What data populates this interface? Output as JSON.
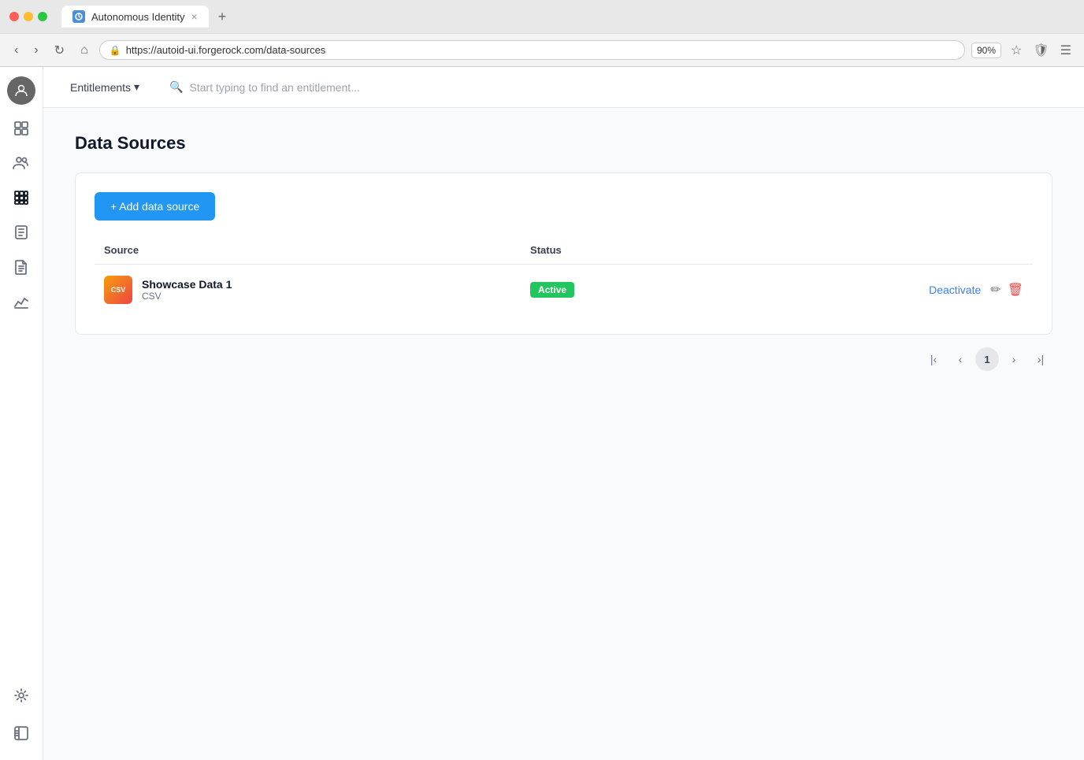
{
  "browser": {
    "tab_title": "Autonomous Identity",
    "tab_close": "×",
    "tab_add": "+",
    "address": "https://autoid-ui.forgerock.com/data-sources",
    "zoom": "90%",
    "nav": {
      "back": "‹",
      "forward": "›",
      "refresh": "↻",
      "home": "⌂"
    }
  },
  "topnav": {
    "entitlements_label": "Entitlements",
    "search_placeholder": "Start typing to find an entitlement..."
  },
  "sidebar": {
    "items": [
      {
        "id": "dashboard",
        "icon": "grid"
      },
      {
        "id": "users",
        "icon": "users"
      },
      {
        "id": "apps",
        "icon": "grid-apps"
      },
      {
        "id": "tasks",
        "icon": "check-circle"
      },
      {
        "id": "reports",
        "icon": "document"
      },
      {
        "id": "analytics",
        "icon": "chart"
      },
      {
        "id": "settings",
        "icon": "gear"
      }
    ],
    "bottom_items": [
      {
        "id": "sidebar-toggle",
        "icon": "sidebar"
      }
    ]
  },
  "page": {
    "title": "Data Sources",
    "add_button_label": "+ Add data source",
    "table": {
      "columns": [
        "Source",
        "Status"
      ],
      "rows": [
        {
          "icon_text": "CSV",
          "name": "Showcase Data 1",
          "type": "CSV",
          "status": "Active",
          "status_color": "#22c55e",
          "deactivate_label": "Deactivate"
        }
      ]
    },
    "pagination": {
      "first": "|‹",
      "prev": "‹",
      "current": "1",
      "next": "›",
      "last": "›|"
    }
  }
}
